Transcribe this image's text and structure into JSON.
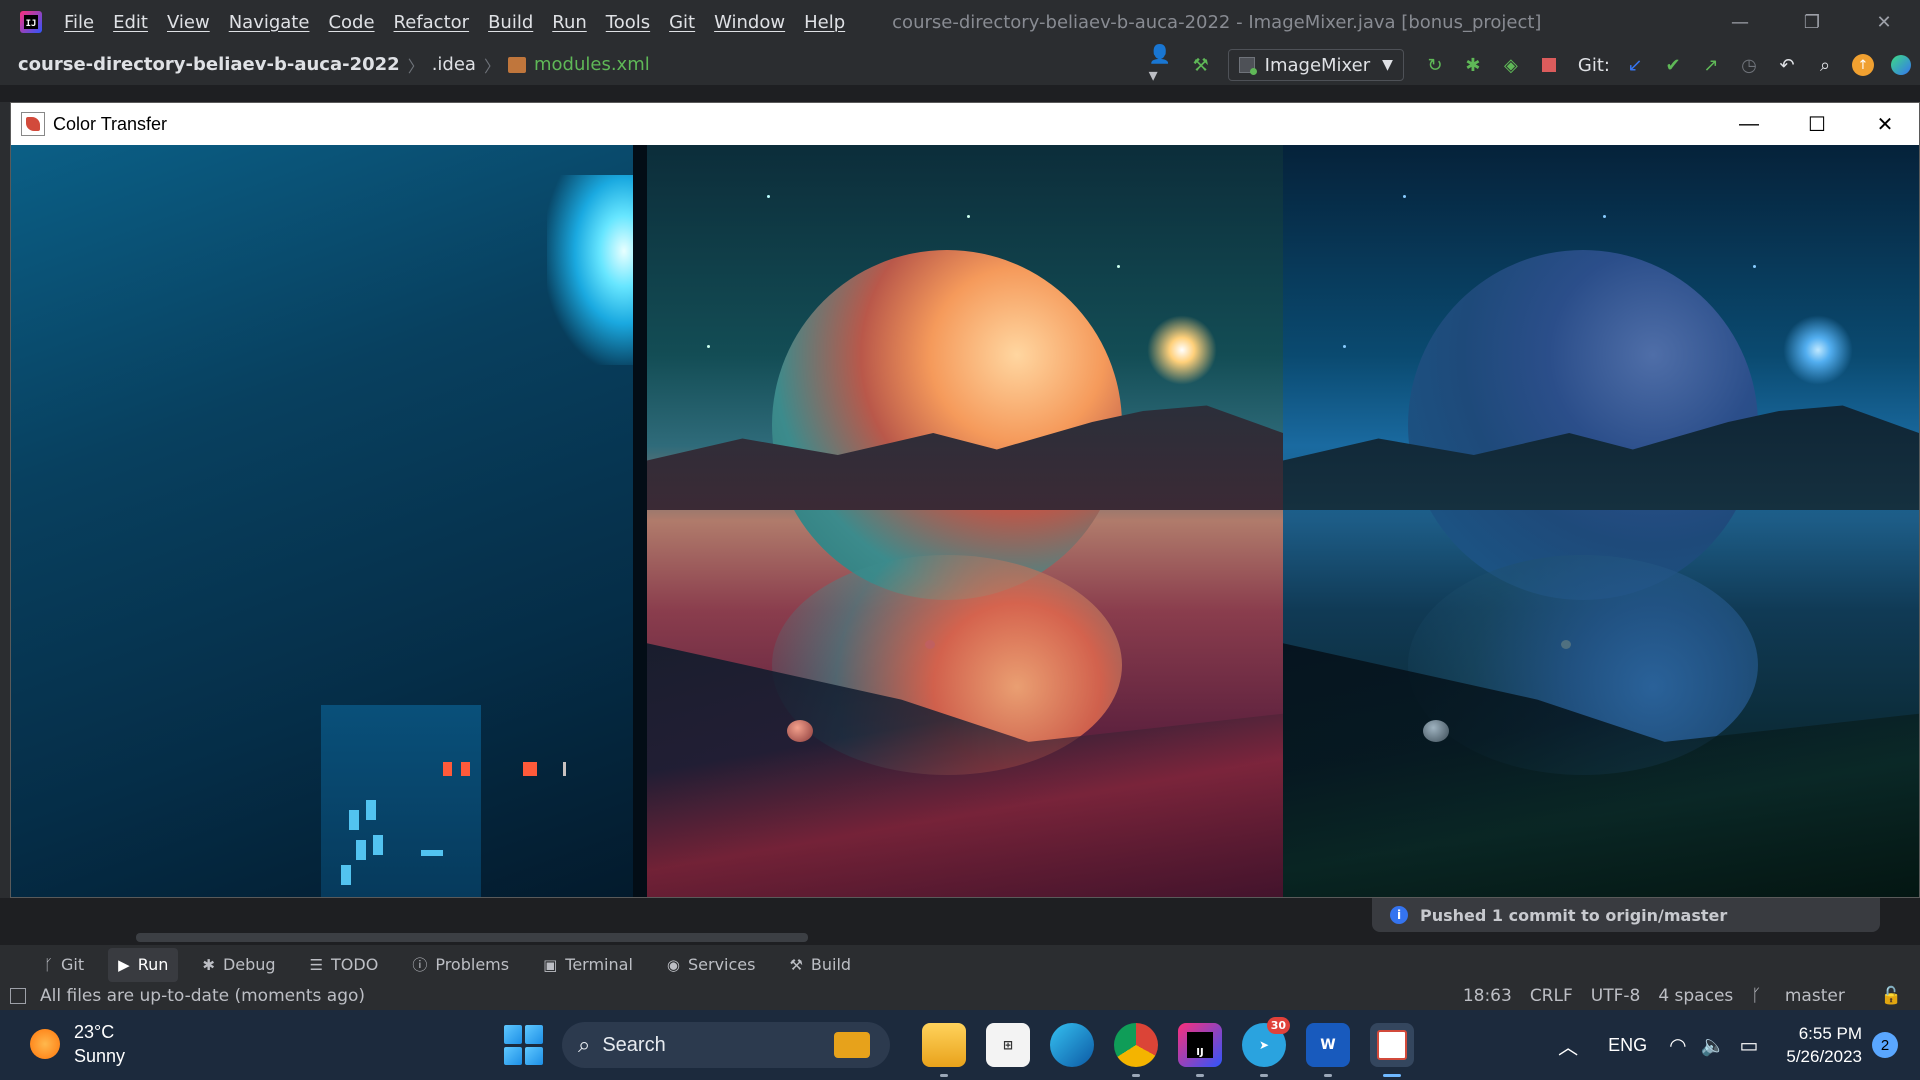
{
  "ide": {
    "logo_text": "IJ",
    "menu": [
      "File",
      "Edit",
      "View",
      "Navigate",
      "Code",
      "Refactor",
      "Build",
      "Run",
      "Tools",
      "Git",
      "Window",
      "Help"
    ],
    "window_title": "course-directory-beliaev-b-auca-2022 - ImageMixer.java [bonus_project]",
    "breadcrumbs": {
      "project": "course-directory-beliaev-b-auca-2022",
      "folder": ".idea",
      "file": "modules.xml"
    },
    "run_config": "ImageMixer",
    "git_label": "Git:",
    "notification": "Pushed 1 commit to origin/master",
    "tool_tabs": [
      "Git",
      "Run",
      "Debug",
      "TODO",
      "Problems",
      "Terminal",
      "Services",
      "Build"
    ],
    "status": {
      "message": "All files are up-to-date (moments ago)",
      "position": "18:63",
      "line_sep": "CRLF",
      "encoding": "UTF-8",
      "indent": "4 spaces",
      "branch": "master"
    }
  },
  "app_window": {
    "title": "Color Transfer",
    "panes": [
      "source-image",
      "target-image",
      "result-image"
    ]
  },
  "taskbar": {
    "weather": {
      "temp": "23°C",
      "condition": "Sunny"
    },
    "search_label": "Search",
    "telegram_badge": "30",
    "lang": "ENG",
    "time": "6:55 PM",
    "date": "5/26/2023",
    "notifications": "2"
  },
  "colors": {
    "ide_bg": "#2b2d30",
    "taskbar_bg": "#1c2a3d",
    "git_green": "#5fb857",
    "accent_blue": "#3574f0"
  }
}
